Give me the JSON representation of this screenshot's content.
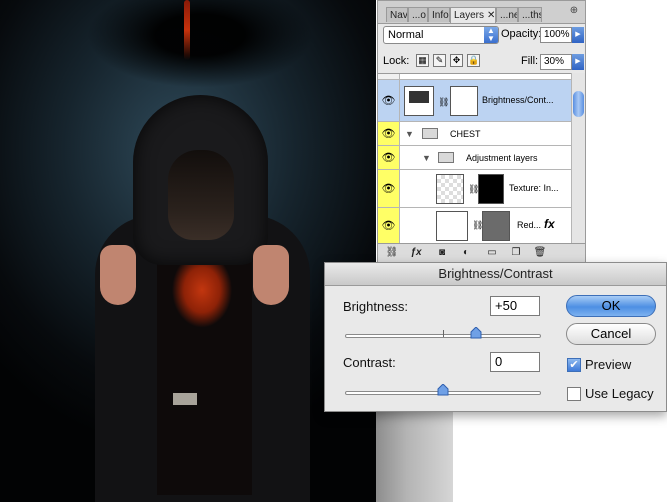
{
  "layers_panel": {
    "tabs": [
      {
        "label": "Nav"
      },
      {
        "label": "...o"
      },
      {
        "label": "Info"
      },
      {
        "label": "Layers",
        "close": "✕"
      },
      {
        "label": "...nels"
      },
      {
        "label": "...ths"
      }
    ],
    "blend_mode": "Normal",
    "opacity_label": "Opacity:",
    "opacity_value": "100%",
    "lock_label": "Lock:",
    "fill_label": "Fill:",
    "fill_value": "30%",
    "layers": [
      {
        "name": "Brightness/Cont...",
        "eye": "👁"
      },
      {
        "name": "CHEST",
        "eye": "👁"
      },
      {
        "name": "Adjustment layers",
        "eye": "👁"
      },
      {
        "name": "Texture: In...",
        "eye": "👁"
      },
      {
        "name": "Red...",
        "eye": "👁",
        "fx": "fx"
      }
    ]
  },
  "dialog": {
    "title": "Brightness/Contrast",
    "brightness_label": "Brightness:",
    "brightness_value": "+50",
    "contrast_label": "Contrast:",
    "contrast_value": "0",
    "ok_label": "OK",
    "cancel_label": "Cancel",
    "preview_label": "Preview",
    "preview_checked": true,
    "legacy_label": "Use Legacy",
    "legacy_checked": false
  },
  "colors": {
    "selection": "#bcd3f2",
    "eye_highlight": "#ffff66",
    "ok_button": "#4d8fe3"
  }
}
